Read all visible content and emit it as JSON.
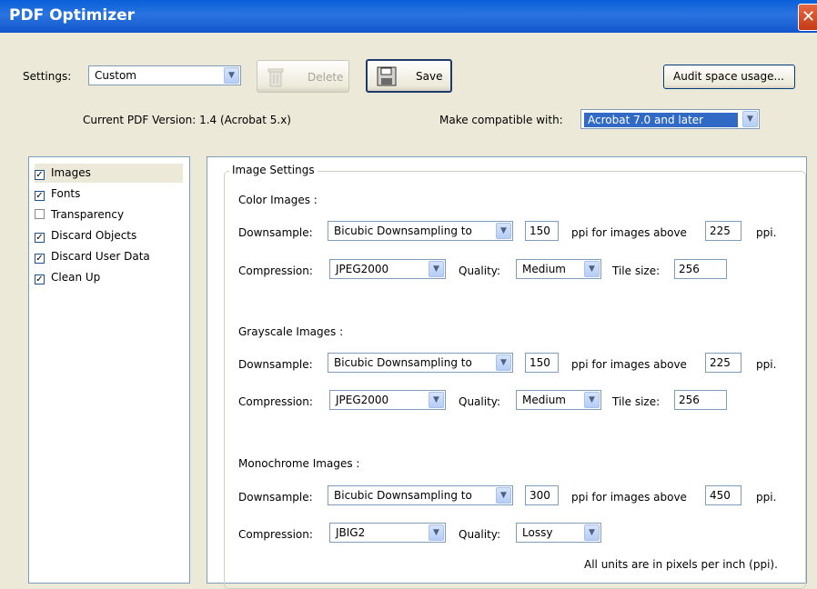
{
  "window": {
    "title": "PDF Optimizer",
    "close_glyph": "✕"
  },
  "toolbar": {
    "settings_label": "Settings:",
    "settings_value": "Custom",
    "delete_label": "Delete",
    "save_label": "Save",
    "audit_label": "Audit space usage..."
  },
  "version": {
    "current_text": "Current PDF Version: 1.4 (Acrobat 5.x)",
    "compat_label": "Make compatible with:",
    "compat_value": "Acrobat 7.0 and later"
  },
  "categories": [
    {
      "label": "Images",
      "checked": true,
      "selected": true
    },
    {
      "label": "Fonts",
      "checked": true
    },
    {
      "label": "Transparency",
      "checked": false
    },
    {
      "label": "Discard Objects",
      "checked": true
    },
    {
      "label": "Discard User Data",
      "checked": true
    },
    {
      "label": "Clean Up",
      "checked": true
    }
  ],
  "image_settings": {
    "group_title": "Image Settings",
    "downsample_label": "Downsample:",
    "compression_label": "Compression:",
    "quality_label": "Quality:",
    "tile_label": "Tile size:",
    "ppi_above_label": "ppi for images above",
    "ppi_label": "ppi.",
    "color": {
      "title": "Color Images :",
      "method": "Bicubic Downsampling to",
      "ppi": "150",
      "above": "225",
      "compression": "JPEG2000",
      "quality": "Medium",
      "tile": "256"
    },
    "grayscale": {
      "title": "Grayscale Images :",
      "method": "Bicubic Downsampling to",
      "ppi": "150",
      "above": "225",
      "compression": "JPEG2000",
      "quality": "Medium",
      "tile": "256"
    },
    "mono": {
      "title": "Monochrome Images :",
      "method": "Bicubic Downsampling to",
      "ppi": "300",
      "above": "450",
      "compression": "JBIG2",
      "quality": "Lossy"
    },
    "units_note": "All units are in pixels per inch (ppi)."
  },
  "icons": {
    "combo_arrow": "chevron-down-icon",
    "delete": "trash-icon",
    "save": "floppy-disk-icon",
    "check": "checkmark-icon"
  }
}
